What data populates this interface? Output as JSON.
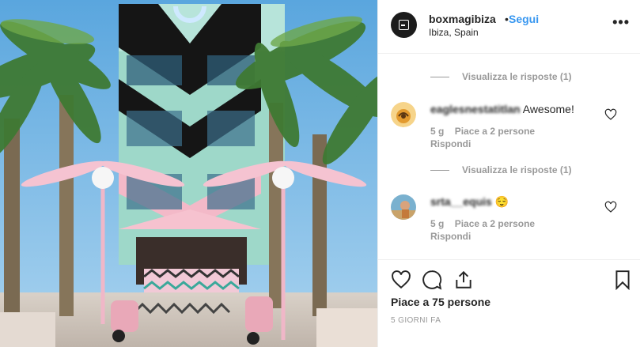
{
  "post": {
    "username": "boxmagibiza",
    "separator": "•",
    "follow_label": "Segui",
    "location": "Ibiza, Spain",
    "more_label": "•••",
    "likes_text": "Piace a 75 persone",
    "time_text": "5 GIORNI FA"
  },
  "comments": [
    {
      "username": "eaglesnestatitlan",
      "text": "Awesome!",
      "age": "5 g",
      "likes": "Piace a 2 persone",
      "reply_label": "Rispondi"
    },
    {
      "username": "srta__equis",
      "text": "😌",
      "age": "5 g",
      "likes": "Piace a 2 persone",
      "reply_label": "Rispondi"
    }
  ],
  "view_replies": [
    {
      "label": "Visualizza le risposte (1)"
    },
    {
      "label": "Visualizza le risposte (1)"
    }
  ],
  "icons": {
    "like": "heart-icon",
    "comment": "comment-icon",
    "share": "share-icon",
    "save": "bookmark-icon"
  },
  "colors": {
    "accent": "#3897f0",
    "text": "#262626",
    "muted": "#999999",
    "divider": "#efefef"
  }
}
